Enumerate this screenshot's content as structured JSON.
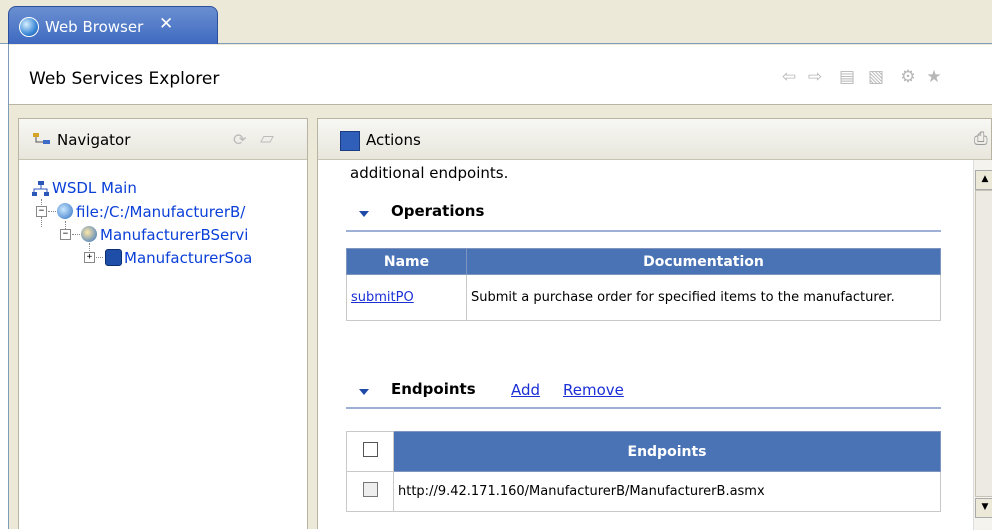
{
  "tab": {
    "title": "Web Browser",
    "close_icon": "close-icon"
  },
  "titlebar": {
    "title": "Web Services Explorer"
  },
  "navigator": {
    "title": "Navigator",
    "items": [
      {
        "label": "WSDL Main"
      },
      {
        "label": "file:/C:/ManufacturerB/"
      },
      {
        "label": "ManufacturerBServi"
      },
      {
        "label": "ManufacturerSoa"
      }
    ]
  },
  "actions": {
    "title": "Actions",
    "intro_text": "additional endpoints.",
    "operations": {
      "heading": "Operations",
      "columns": [
        "Name",
        "Documentation"
      ],
      "rows": [
        {
          "name": "submitPO",
          "doc": "Submit a purchase order for specified items to the manufacturer."
        }
      ]
    },
    "endpoints": {
      "heading": "Endpoints",
      "add_label": "Add",
      "remove_label": "Remove",
      "column": "Endpoints",
      "rows": [
        {
          "url": "http://9.42.171.160/ManufacturerB/ManufacturerB.asmx"
        }
      ]
    }
  },
  "colors": {
    "table_header": "#4a73b6",
    "link": "#1a2fd6",
    "tree_text": "#0a3fd8"
  }
}
